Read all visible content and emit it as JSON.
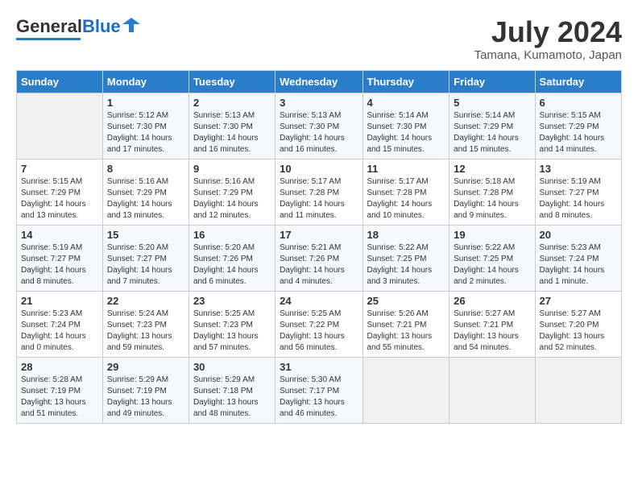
{
  "header": {
    "logo_general": "General",
    "logo_blue": "Blue",
    "month_year": "July 2024",
    "location": "Tamana, Kumamoto, Japan"
  },
  "calendar": {
    "days_of_week": [
      "Sunday",
      "Monday",
      "Tuesday",
      "Wednesday",
      "Thursday",
      "Friday",
      "Saturday"
    ],
    "weeks": [
      [
        {
          "day": "",
          "info": ""
        },
        {
          "day": "1",
          "info": "Sunrise: 5:12 AM\nSunset: 7:30 PM\nDaylight: 14 hours\nand 17 minutes."
        },
        {
          "day": "2",
          "info": "Sunrise: 5:13 AM\nSunset: 7:30 PM\nDaylight: 14 hours\nand 16 minutes."
        },
        {
          "day": "3",
          "info": "Sunrise: 5:13 AM\nSunset: 7:30 PM\nDaylight: 14 hours\nand 16 minutes."
        },
        {
          "day": "4",
          "info": "Sunrise: 5:14 AM\nSunset: 7:30 PM\nDaylight: 14 hours\nand 15 minutes."
        },
        {
          "day": "5",
          "info": "Sunrise: 5:14 AM\nSunset: 7:29 PM\nDaylight: 14 hours\nand 15 minutes."
        },
        {
          "day": "6",
          "info": "Sunrise: 5:15 AM\nSunset: 7:29 PM\nDaylight: 14 hours\nand 14 minutes."
        }
      ],
      [
        {
          "day": "7",
          "info": "Sunrise: 5:15 AM\nSunset: 7:29 PM\nDaylight: 14 hours\nand 13 minutes."
        },
        {
          "day": "8",
          "info": "Sunrise: 5:16 AM\nSunset: 7:29 PM\nDaylight: 14 hours\nand 13 minutes."
        },
        {
          "day": "9",
          "info": "Sunrise: 5:16 AM\nSunset: 7:29 PM\nDaylight: 14 hours\nand 12 minutes."
        },
        {
          "day": "10",
          "info": "Sunrise: 5:17 AM\nSunset: 7:28 PM\nDaylight: 14 hours\nand 11 minutes."
        },
        {
          "day": "11",
          "info": "Sunrise: 5:17 AM\nSunset: 7:28 PM\nDaylight: 14 hours\nand 10 minutes."
        },
        {
          "day": "12",
          "info": "Sunrise: 5:18 AM\nSunset: 7:28 PM\nDaylight: 14 hours\nand 9 minutes."
        },
        {
          "day": "13",
          "info": "Sunrise: 5:19 AM\nSunset: 7:27 PM\nDaylight: 14 hours\nand 8 minutes."
        }
      ],
      [
        {
          "day": "14",
          "info": "Sunrise: 5:19 AM\nSunset: 7:27 PM\nDaylight: 14 hours\nand 8 minutes."
        },
        {
          "day": "15",
          "info": "Sunrise: 5:20 AM\nSunset: 7:27 PM\nDaylight: 14 hours\nand 7 minutes."
        },
        {
          "day": "16",
          "info": "Sunrise: 5:20 AM\nSunset: 7:26 PM\nDaylight: 14 hours\nand 6 minutes."
        },
        {
          "day": "17",
          "info": "Sunrise: 5:21 AM\nSunset: 7:26 PM\nDaylight: 14 hours\nand 4 minutes."
        },
        {
          "day": "18",
          "info": "Sunrise: 5:22 AM\nSunset: 7:25 PM\nDaylight: 14 hours\nand 3 minutes."
        },
        {
          "day": "19",
          "info": "Sunrise: 5:22 AM\nSunset: 7:25 PM\nDaylight: 14 hours\nand 2 minutes."
        },
        {
          "day": "20",
          "info": "Sunrise: 5:23 AM\nSunset: 7:24 PM\nDaylight: 14 hours\nand 1 minute."
        }
      ],
      [
        {
          "day": "21",
          "info": "Sunrise: 5:23 AM\nSunset: 7:24 PM\nDaylight: 14 hours\nand 0 minutes."
        },
        {
          "day": "22",
          "info": "Sunrise: 5:24 AM\nSunset: 7:23 PM\nDaylight: 13 hours\nand 59 minutes."
        },
        {
          "day": "23",
          "info": "Sunrise: 5:25 AM\nSunset: 7:23 PM\nDaylight: 13 hours\nand 57 minutes."
        },
        {
          "day": "24",
          "info": "Sunrise: 5:25 AM\nSunset: 7:22 PM\nDaylight: 13 hours\nand 56 minutes."
        },
        {
          "day": "25",
          "info": "Sunrise: 5:26 AM\nSunset: 7:21 PM\nDaylight: 13 hours\nand 55 minutes."
        },
        {
          "day": "26",
          "info": "Sunrise: 5:27 AM\nSunset: 7:21 PM\nDaylight: 13 hours\nand 54 minutes."
        },
        {
          "day": "27",
          "info": "Sunrise: 5:27 AM\nSunset: 7:20 PM\nDaylight: 13 hours\nand 52 minutes."
        }
      ],
      [
        {
          "day": "28",
          "info": "Sunrise: 5:28 AM\nSunset: 7:19 PM\nDaylight: 13 hours\nand 51 minutes."
        },
        {
          "day": "29",
          "info": "Sunrise: 5:29 AM\nSunset: 7:19 PM\nDaylight: 13 hours\nand 49 minutes."
        },
        {
          "day": "30",
          "info": "Sunrise: 5:29 AM\nSunset: 7:18 PM\nDaylight: 13 hours\nand 48 minutes."
        },
        {
          "day": "31",
          "info": "Sunrise: 5:30 AM\nSunset: 7:17 PM\nDaylight: 13 hours\nand 46 minutes."
        },
        {
          "day": "",
          "info": ""
        },
        {
          "day": "",
          "info": ""
        },
        {
          "day": "",
          "info": ""
        }
      ]
    ]
  }
}
